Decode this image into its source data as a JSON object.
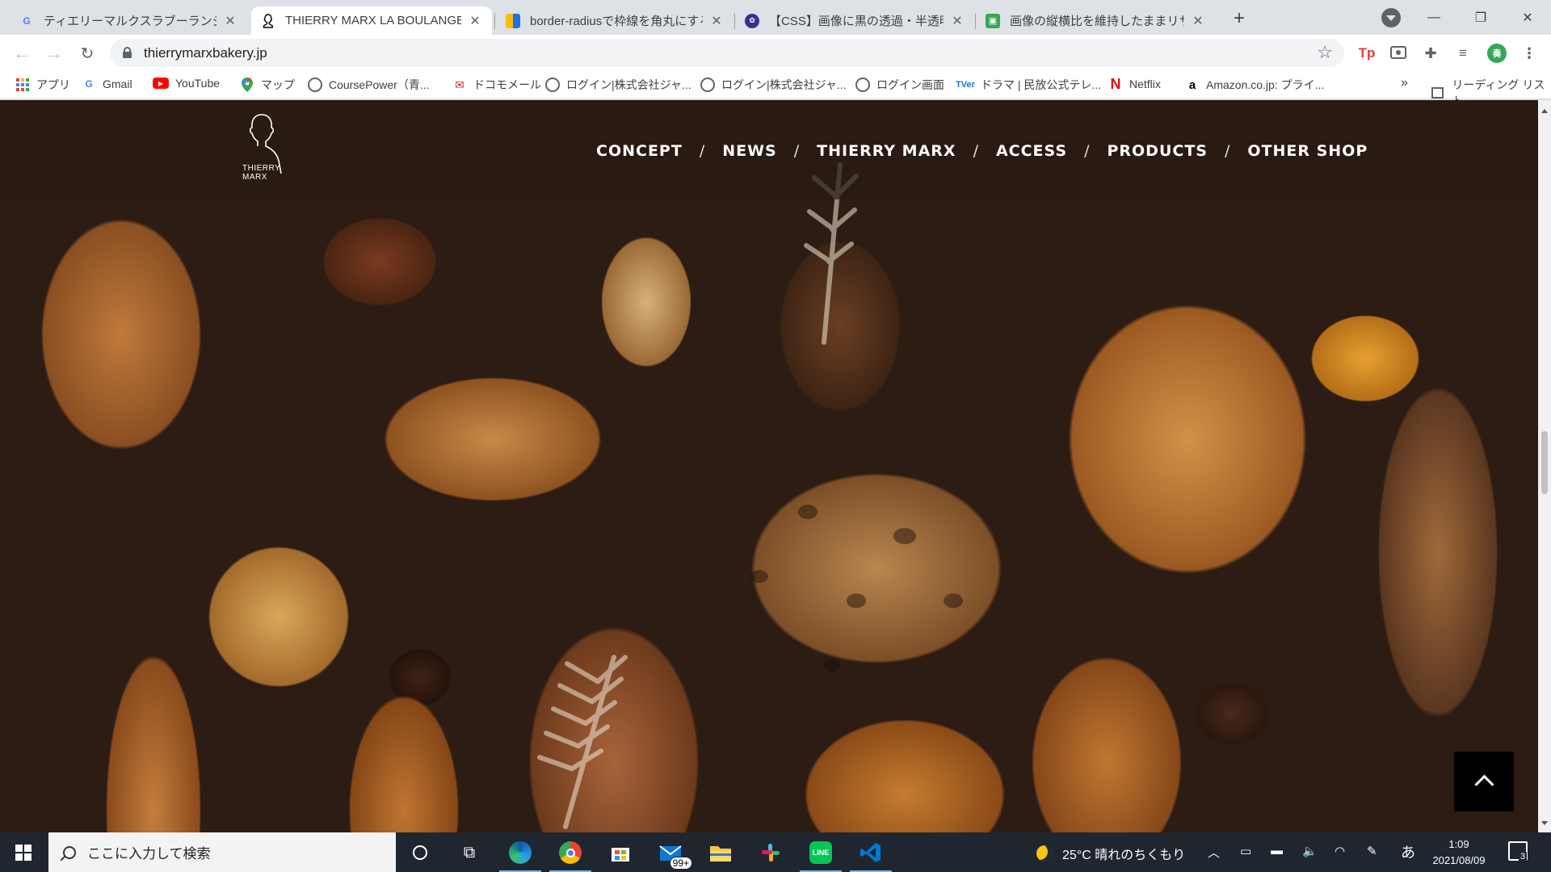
{
  "tabs": [
    {
      "title": "ティエリーマルクスラブーランジュリー - G",
      "favicon": "G",
      "favicon_color": "#4285f4",
      "favicon_bg": "transparent"
    },
    {
      "title": "THIERRY MARX LA BOULANGERIE",
      "favicon": "TM",
      "favicon_color": "#000000",
      "favicon_bg": "transparent"
    },
    {
      "title": "border-radiusで枠線を角丸にする |",
      "favicon": "▮▮",
      "favicon_color": "#1a73e8",
      "favicon_bg": "#fbbc04"
    },
    {
      "title": "【CSS】画像に黒の透過・半透明カラ",
      "favicon": "◉",
      "favicon_color": "#3b2f8f",
      "favicon_bg": "transparent"
    },
    {
      "title": "画像の縦横比を維持したままリサイズ",
      "favicon": "▣",
      "favicon_color": "#ffffff",
      "favicon_bg": "#34a853"
    }
  ],
  "address": {
    "url": "thierrymarxbakery.jp"
  },
  "bookmarks": [
    {
      "label": "アプリ",
      "icon": "apps-grid-icon"
    },
    {
      "label": "Gmail",
      "icon": "google-icon"
    },
    {
      "label": "YouTube",
      "icon": "youtube-icon"
    },
    {
      "label": "マップ",
      "icon": "maps-pin-icon"
    },
    {
      "label": "CoursePower（青...",
      "icon": "globe-icon"
    },
    {
      "label": "ドコモメール",
      "icon": "mail-icon"
    },
    {
      "label": "ログイン|株式会社ジャ...",
      "icon": "globe-icon"
    },
    {
      "label": "ログイン|株式会社ジャ...",
      "icon": "globe-icon"
    },
    {
      "label": "ログイン画面",
      "icon": "globe-icon"
    },
    {
      "label": "ドラマ | 民放公式テレ...",
      "icon": "tver-icon"
    },
    {
      "label": "Netflix",
      "icon": "netflix-icon"
    },
    {
      "label": "Amazon.co.jp: プライ...",
      "icon": "amazon-icon"
    }
  ],
  "bookmarks_more": "»",
  "reading_list": "リーディング リスト",
  "site": {
    "logo_text_line1": "THIERRY",
    "logo_text_line2": "MARX",
    "nav": [
      "CONCEPT",
      "NEWS",
      "THIERRY MARX",
      "ACCESS",
      "PRODUCTS",
      "OTHER SHOP"
    ],
    "nav_separator": "/"
  },
  "taskbar": {
    "search_placeholder": "ここに入力して検索",
    "weather": "25°C  晴れのちくもり",
    "time": "1:09",
    "date": "2021/08/09",
    "store_badge": "99+",
    "notification_count": "3",
    "ime": "あ"
  },
  "colors": {
    "chrome_bg": "#dee1e6",
    "header_overlay": "rgba(40,26,18,0.72)",
    "taskbar": "#1f2630",
    "accent_green": "#06c755",
    "vscode_blue": "#0078d4"
  }
}
